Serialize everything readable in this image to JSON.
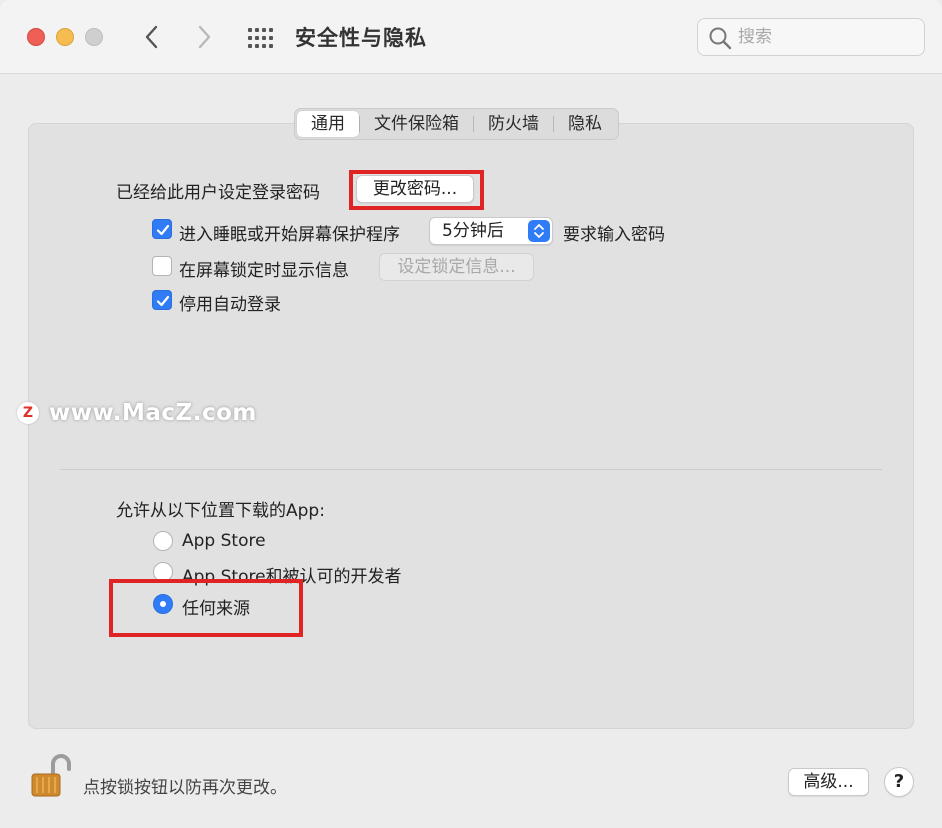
{
  "window": {
    "title": "安全性与隐私",
    "search_placeholder": "搜索",
    "traffic_lights": [
      "close",
      "minimize",
      "maximize"
    ],
    "nav_icons": [
      "chevron-left-icon",
      "chevron-right-icon",
      "grid-icon"
    ]
  },
  "tabs": [
    {
      "label": "通用",
      "active": true
    },
    {
      "label": "文件保险箱",
      "active": false
    },
    {
      "label": "防火墙",
      "active": false
    },
    {
      "label": "隐私",
      "active": false
    }
  ],
  "general": {
    "password_label": "已经给此用户设定登录密码",
    "change_password_button": "更改密码...",
    "require_password": {
      "label_before": "进入睡眠或开始屏幕保护程序",
      "select_value": "5分钟后",
      "label_after": "要求输入密码",
      "checked": true
    },
    "show_message": {
      "label": "在屏幕锁定时显示信息",
      "button": "设定锁定信息...",
      "checked": false
    },
    "disable_auto_login": {
      "label": "停用自动登录",
      "checked": true
    }
  },
  "watermark": {
    "logo": "Z",
    "text": "www.MacZ.com"
  },
  "downloads": {
    "heading": "允许从以下位置下载的App:",
    "options": [
      {
        "label": "App Store",
        "selected": false
      },
      {
        "label": "App Store和被认可的开发者",
        "selected": false
      },
      {
        "label": "任何来源",
        "selected": true
      }
    ]
  },
  "footer": {
    "lock_text": "点按锁按钮以防再次更改。",
    "advanced_button": "高级...",
    "help_button": "?"
  },
  "colors": {
    "accent": "#2f7cf6",
    "highlight": "#e02424"
  }
}
